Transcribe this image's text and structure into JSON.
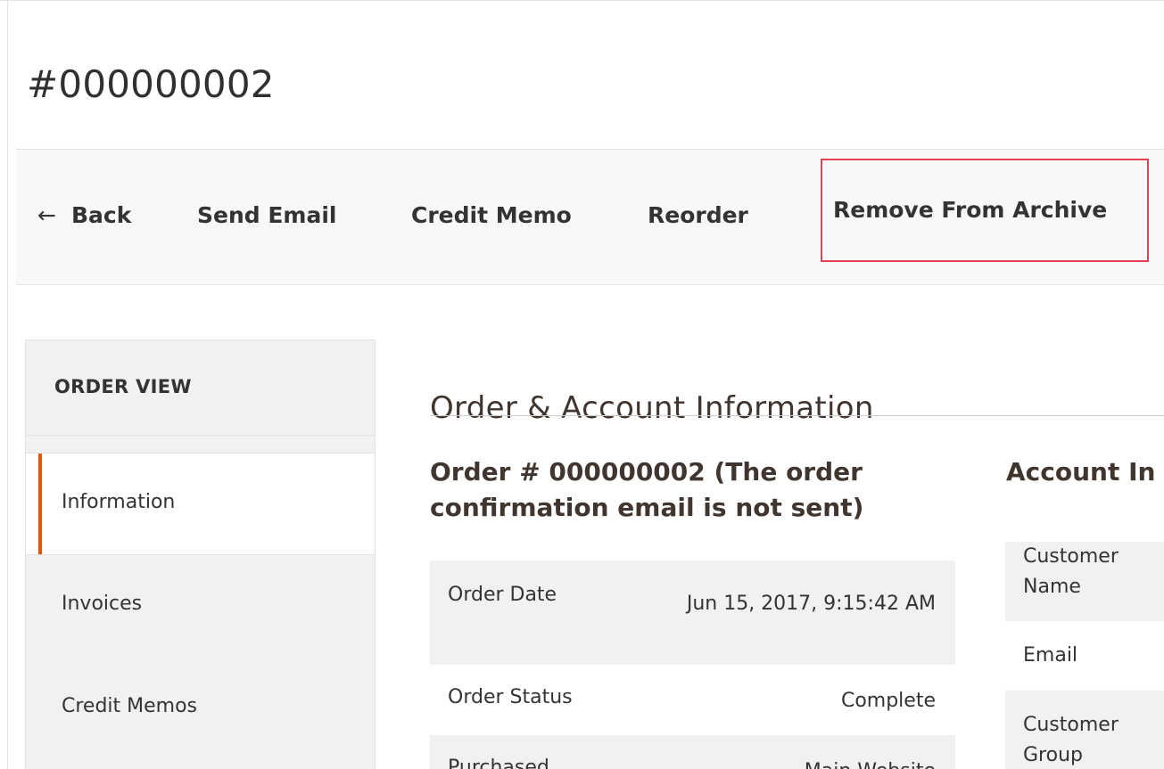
{
  "page": {
    "title": "#000000002"
  },
  "toolbar": {
    "back_label": "Back",
    "back_icon": "arrow-left-icon",
    "send_email_label": "Send Email",
    "credit_memo_label": "Credit Memo",
    "reorder_label": "Reorder",
    "remove_from_archive_label": "Remove From Archive",
    "highlight_color": "#e04351"
  },
  "sidebar": {
    "title": "ORDER VIEW",
    "accent_color": "#eb5202",
    "items": [
      {
        "label": "Information",
        "active": true
      },
      {
        "label": "Invoices",
        "active": false
      },
      {
        "label": "Credit Memos",
        "active": false
      }
    ]
  },
  "main": {
    "section_title": "Order & Account Information",
    "order": {
      "heading": "Order # 000000002 (The order confirmation email is not sent)",
      "rows": [
        {
          "label": "Order Date",
          "value": "Jun 15, 2017, 9:15:42 AM"
        },
        {
          "label": "Order Status",
          "value": "Complete"
        },
        {
          "label": "Purchased",
          "value": "Main Website"
        }
      ]
    },
    "account": {
      "heading": "Account In",
      "rows": [
        {
          "label": "Customer Name"
        },
        {
          "label": "Email"
        },
        {
          "label": "Customer Group"
        }
      ]
    }
  }
}
